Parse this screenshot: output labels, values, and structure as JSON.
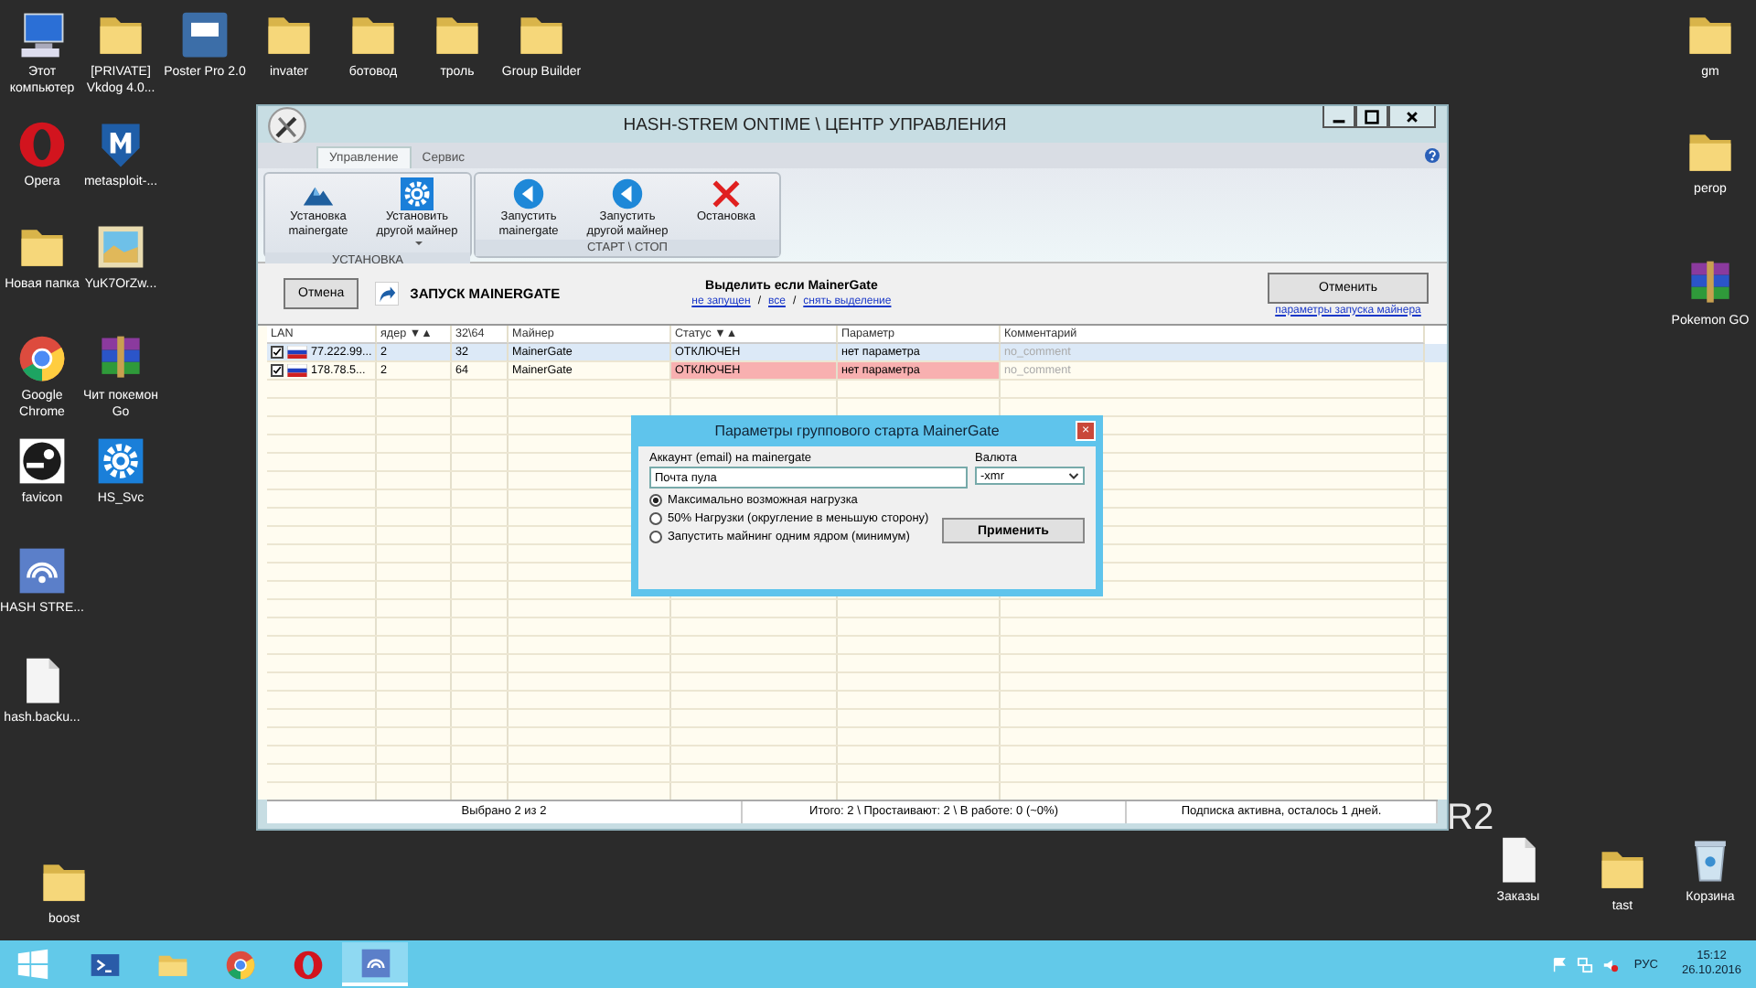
{
  "desktop": {
    "icons": [
      {
        "label": "Этот компьютер",
        "kind": "computer"
      },
      {
        "label": "[PRIVATE] Vkdog 4.0...",
        "kind": "folder"
      },
      {
        "label": "Poster Pro 2.0",
        "kind": "tile"
      },
      {
        "label": "invater",
        "kind": "folder"
      },
      {
        "label": "ботовод",
        "kind": "folder"
      },
      {
        "label": "троль",
        "kind": "folder"
      },
      {
        "label": "Group Builder",
        "kind": "folder"
      },
      {
        "label": "gm",
        "kind": "folder"
      },
      {
        "label": "Opera",
        "kind": "opera"
      },
      {
        "label": "metasploit-...",
        "kind": "shield"
      },
      {
        "label": "perop",
        "kind": "folder"
      },
      {
        "label": "Новая папка",
        "kind": "folder"
      },
      {
        "label": "YuK7OrZw...",
        "kind": "image"
      },
      {
        "label": "Pokemon GO",
        "kind": "archive"
      },
      {
        "label": "Google Chrome",
        "kind": "chrome"
      },
      {
        "label": "Чит покемон Go",
        "kind": "archive"
      },
      {
        "label": "favicon",
        "kind": "steam"
      },
      {
        "label": "HS_Svc",
        "kind": "gear"
      },
      {
        "label": "HASH STRE...",
        "kind": "wifi"
      },
      {
        "label": "hash.backu...",
        "kind": "file"
      },
      {
        "label": "boost",
        "kind": "folder"
      },
      {
        "label": "Заказы",
        "kind": "file"
      },
      {
        "label": "tast",
        "kind": "folder"
      },
      {
        "label": "Корзина",
        "kind": "bin"
      }
    ],
    "edition_text": "R2"
  },
  "window": {
    "title": "HASH-STREM ONTIME \\ ЦЕНТР УПРАВЛЕНИЯ",
    "tabs": [
      {
        "label": "Управление",
        "selected": true
      },
      {
        "label": "Сервис",
        "selected": false
      }
    ],
    "ribbon_groups": [
      {
        "title": "УСТАНОВКА",
        "buttons": [
          {
            "label": "Установка mainergate",
            "kind": "mountain"
          },
          {
            "label": "Установить другой майнер",
            "kind": "gear",
            "dropdown": true
          }
        ]
      },
      {
        "title": "СТАРТ \\ СТОП",
        "buttons": [
          {
            "label": "Запустить mainergate",
            "kind": "play"
          },
          {
            "label": "Запустить другой майнер",
            "kind": "play",
            "dropdown": false
          },
          {
            "label": "Остановка",
            "kind": "stop"
          }
        ]
      }
    ],
    "toolbar": {
      "cancel_button": "Отмена",
      "launch_title": "ЗАПУСК MAINERGATE",
      "select_title": "Выделить если MainerGate",
      "select_links": [
        {
          "label": "не запущен",
          "kind": "link"
        },
        {
          "label": "/",
          "kind": "sep"
        },
        {
          "label": "все",
          "kind": "link"
        },
        {
          "label": "/",
          "kind": "sep"
        },
        {
          "label": "снять выделение",
          "kind": "link"
        }
      ],
      "undo_button": "Отменить",
      "params_link": "параметры запуска майнера"
    },
    "table": {
      "columns": [
        "LAN",
        "ядер ▼▲",
        "32\\64",
        "Майнер",
        "Статус ▼▲",
        "Параметр",
        "Комментарий"
      ],
      "rows": [
        {
          "checked": true,
          "selected": true,
          "alert": false,
          "cells": [
            "77.222.99...",
            "2",
            "32",
            "MainerGate",
            "ОТКЛЮЧЕН",
            "нет параметра",
            "no_comment"
          ]
        },
        {
          "checked": true,
          "selected": false,
          "alert": true,
          "cells": [
            "178.78.5...",
            "2",
            "64",
            "MainerGate",
            "ОТКЛЮЧЕН",
            "нет параметра",
            "no_comment"
          ]
        }
      ]
    },
    "status_bar": [
      "Выбрано 2 из 2",
      "Итого: 2 \\ Простаивают: 2 \\ В работе: 0 (~0%)",
      "Подписка активна, осталось 1 дней."
    ],
    "dialog": {
      "title": "Параметры группового старта MainerGate",
      "close": "×",
      "account_label": "Аккаунт (email) на mainergate",
      "account_value": "Почта пула",
      "currency_label": "Валюта",
      "currency_value": "-xmr",
      "options": [
        {
          "label": "Максимально возможная нагрузка",
          "selected": true
        },
        {
          "label": "50% Нагрузки (округление в меньшую сторону)",
          "selected": false
        },
        {
          "label": "Запустить майнинг одним ядром (минимум)",
          "selected": false
        }
      ],
      "apply_button": "Применить"
    }
  },
  "taskbar": {
    "apps": [
      {
        "kind": "powershell",
        "selected": false
      },
      {
        "kind": "explorer",
        "selected": false
      },
      {
        "kind": "chrome",
        "selected": false
      },
      {
        "kind": "opera",
        "selected": false
      },
      {
        "kind": "wifi",
        "selected": true
      }
    ],
    "language": "РУС",
    "time": "15:12",
    "date": "26.10.2016"
  }
}
